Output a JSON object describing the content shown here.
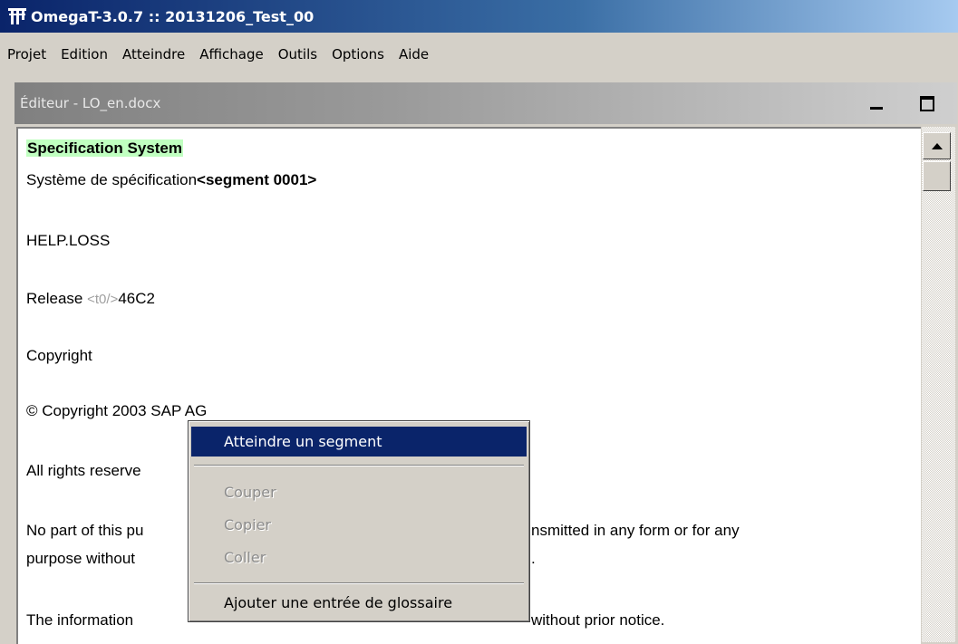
{
  "window": {
    "title": "OmegaT-3.0.7 :: 20131206_Test_00",
    "icon": "omegat-logo-icon"
  },
  "menubar": {
    "items": [
      "Projet",
      "Edition",
      "Atteindre",
      "Affichage",
      "Outils",
      "Options",
      "Aide"
    ]
  },
  "editor_pane": {
    "title": "Éditeur - LO_en.docx",
    "minimize_icon": "minimize-icon",
    "maximize_icon": "maximize-icon"
  },
  "editor": {
    "active_source": "Specification System",
    "active_target": "Système de spécification",
    "active_segment_marker": "<segment 0001>",
    "segments": [
      "HELP.LOSS",
      "Release ",
      "Copyright",
      "© Copyright 2003 SAP AG",
      "All rights reserve",
      "No part of this pu",
      "purpose without",
      "The information"
    ],
    "release_tag": "<t0/>",
    "release_value": "46C2",
    "right_fragments": [
      "nsmitted in any form or for any",
      ".",
      "without prior notice."
    ]
  },
  "context_menu": {
    "items": [
      {
        "label": "Atteindre un segment",
        "state": "active"
      },
      {
        "label": "Couper",
        "state": "disabled"
      },
      {
        "label": "Copier",
        "state": "disabled"
      },
      {
        "label": "Coller",
        "state": "disabled"
      },
      {
        "label": "Ajouter une entrée de glossaire",
        "state": "normal"
      }
    ]
  },
  "colors": {
    "titlebar": "#0a246a",
    "selection": "#0a246a",
    "source_highlight": "#c0ffc0",
    "chrome": "#d4d0c8"
  }
}
